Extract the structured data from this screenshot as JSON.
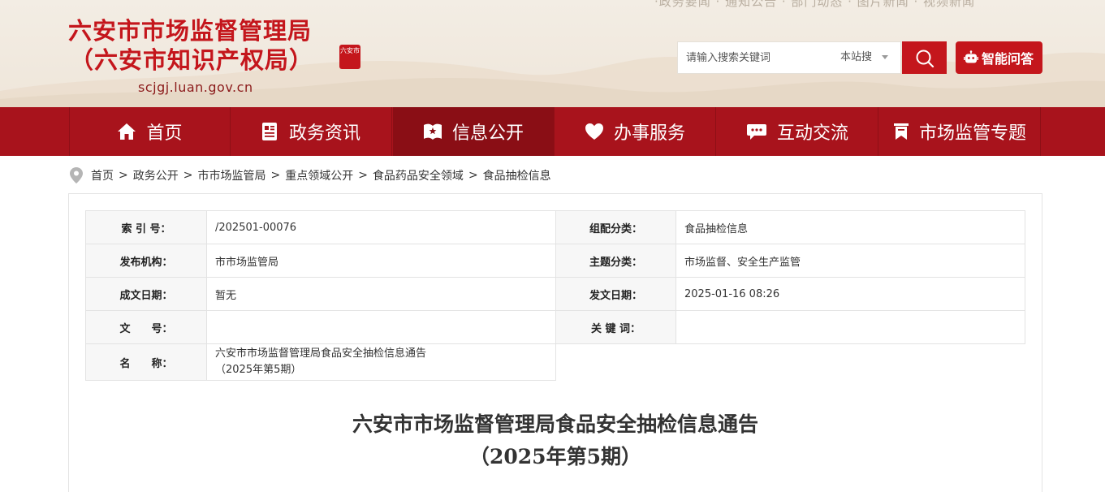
{
  "header": {
    "top_strip": "·政务要闻 · 通知公告 · 部门动态 · 图片新闻 · 视频新闻",
    "title_line1": "六安市市场监督管理局",
    "title_line2": "（六安市知识产权局）",
    "url": "scjgj.luan.gov.cn",
    "seal_text": "六安市",
    "search": {
      "placeholder": "请输入搜索关键词",
      "scope": "本站搜"
    },
    "ai_button": "智能问答"
  },
  "nav": {
    "items": [
      {
        "label": "首页",
        "icon": "home-icon"
      },
      {
        "label": "政务资讯",
        "icon": "news-icon"
      },
      {
        "label": "信息公开",
        "icon": "open-info-icon"
      },
      {
        "label": "办事服务",
        "icon": "heart-icon"
      },
      {
        "label": "互动交流",
        "icon": "chat-icon"
      },
      {
        "label": "市场监管专题",
        "icon": "bookmark-icon"
      }
    ],
    "active_index": 2
  },
  "breadcrumb": {
    "items": [
      "首页",
      "政务公开",
      "市市场监管局",
      "重点领域公开",
      "食品药品安全领域",
      "食品抽检信息"
    ],
    "separator": ">"
  },
  "meta": {
    "index_label": "索 引 号：",
    "index_value": "/202501-00076",
    "category_label": "组配分类：",
    "category_value": "食品抽检信息",
    "publisher_label": "发布机构：",
    "publisher_value": "市市场监管局",
    "topic_label": "主题分类：",
    "topic_value": "市场监督、安全生产监管",
    "created_label": "成文日期：",
    "created_value": "暂无",
    "issued_label": "发文日期：",
    "issued_value": "2025-01-16 08:26",
    "docno_label": "文　　号：",
    "docno_value": "",
    "keywords_label": "关 键 词：",
    "keywords_value": "",
    "name_label": "名　　称：",
    "name_value_line1": "六安市市场监督管理局食品安全抽检信息通告",
    "name_value_line2": "（2025年第5期）"
  },
  "article": {
    "title_line1": "六安市市场监督管理局食品安全抽检信息通告",
    "title_line2": "（2025年第5期）"
  },
  "colors": {
    "brand_red": "#c4161c",
    "nav_red": "#a8131c",
    "nav_active": "#8a0e15"
  }
}
